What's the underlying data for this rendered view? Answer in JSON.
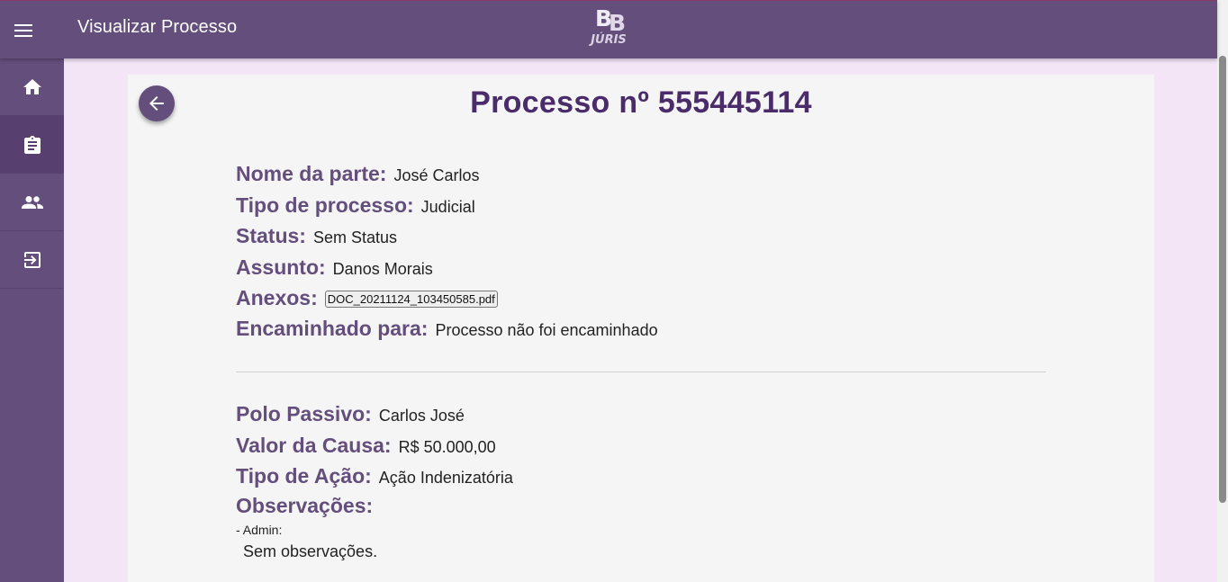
{
  "appbar": {
    "title": "Visualizar Processo",
    "logo_top": "BB",
    "logo_bottom": "JÚRIS",
    "menu_icon": "menu-icon"
  },
  "sidebar": {
    "items": [
      {
        "icon": "home-icon",
        "label": "home"
      },
      {
        "icon": "clipboard-icon",
        "label": "processos",
        "active": true
      },
      {
        "icon": "people-icon",
        "label": "usuarios"
      },
      {
        "icon": "logout-icon",
        "label": "sair"
      }
    ]
  },
  "page": {
    "heading": "Processo nº 555445114",
    "back_icon": "arrow-back-icon"
  },
  "fields": {
    "nome_label": "Nome da parte:",
    "nome_value": "José Carlos",
    "tipo_processo_label": "Tipo de processo:",
    "tipo_processo_value": "Judicial",
    "status_label": "Status:",
    "status_value": "Sem Status",
    "assunto_label": "Assunto:",
    "assunto_value": "Danos Morais",
    "anexos_label": "Anexos:",
    "anexos_file": "DOC_20211124_103450585.pdf",
    "encaminhado_label": "Encaminhado para:",
    "encaminhado_value": "Processo não foi encaminhado",
    "polo_label": "Polo Passivo:",
    "polo_value": "Carlos José",
    "valor_label": "Valor da Causa:",
    "valor_value": "R$ 50.000,00",
    "tipo_acao_label": "Tipo de Ação:",
    "tipo_acao_value": "Ação Indenizatória",
    "obs_label": "Observações:",
    "obs_author": "- Admin:",
    "obs_text": "Sem observações."
  },
  "colors": {
    "primary": "#644e7c",
    "heading": "#4a2c6b",
    "background": "#f3e5f5",
    "card": "#f5f5f5"
  }
}
